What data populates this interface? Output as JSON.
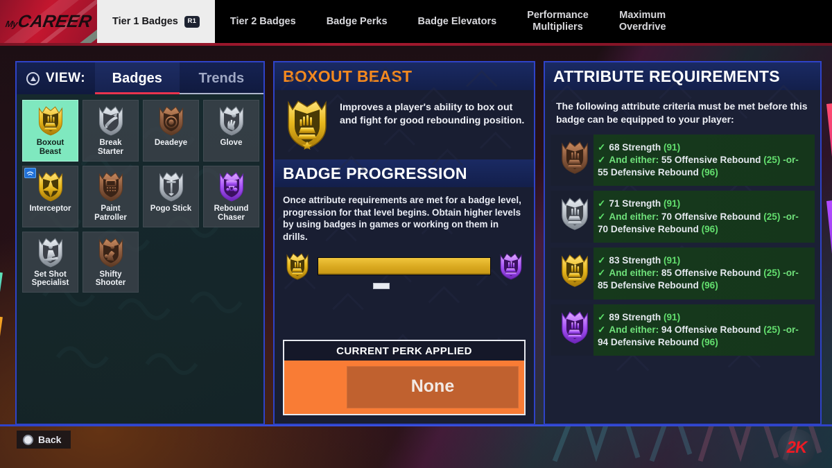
{
  "header": {
    "logo": {
      "prefix": "My",
      "main": "CAREER"
    },
    "tabs": [
      {
        "label": "Tier 1 Badges",
        "active": true,
        "shortcut": "R1"
      },
      {
        "label": "Tier 2 Badges",
        "active": false,
        "shortcut": ""
      },
      {
        "label": "Badge Perks",
        "active": false,
        "shortcut": ""
      },
      {
        "label": "Badge Elevators",
        "active": false,
        "shortcut": ""
      },
      {
        "label": "Performance\nMultipliers",
        "active": false,
        "shortcut": ""
      },
      {
        "label": "Maximum\nOverdrive",
        "active": false,
        "shortcut": ""
      }
    ]
  },
  "left": {
    "view_label": "VIEW:",
    "view_tabs": [
      {
        "label": "Badges",
        "active": true
      },
      {
        "label": "Trends",
        "active": false
      }
    ],
    "badges": [
      {
        "name": "Boxout\nBeast",
        "tier": "gold",
        "selected": true,
        "equipped": false,
        "art": "boxout"
      },
      {
        "name": "Break\nStarter",
        "tier": "silver",
        "selected": false,
        "equipped": false,
        "art": "break"
      },
      {
        "name": "Deadeye",
        "tier": "bronze",
        "selected": false,
        "equipped": false,
        "art": "deadeye"
      },
      {
        "name": "Glove",
        "tier": "silver",
        "selected": false,
        "equipped": false,
        "art": "glove"
      },
      {
        "name": "Interceptor",
        "tier": "gold",
        "selected": false,
        "equipped": true,
        "art": "interceptor"
      },
      {
        "name": "Paint\nPatroller",
        "tier": "bronze",
        "selected": false,
        "equipped": false,
        "art": "paint"
      },
      {
        "name": "Pogo Stick",
        "tier": "silver",
        "selected": false,
        "equipped": false,
        "art": "pogo"
      },
      {
        "name": "Rebound\nChaser",
        "tier": "hof",
        "selected": false,
        "equipped": false,
        "art": "rebound"
      },
      {
        "name": "Set Shot\nSpecialist",
        "tier": "silver",
        "selected": false,
        "equipped": false,
        "art": "setshot"
      },
      {
        "name": "Shifty\nShooter",
        "tier": "bronze",
        "selected": false,
        "equipped": false,
        "art": "shifty"
      }
    ]
  },
  "center": {
    "badge_title": "BOXOUT BEAST",
    "badge_description": "Improves a player's ability to box out and fight for good rebounding position.",
    "progression_title": "BADGE PROGRESSION",
    "progression_description": "Once attribute requirements are met for a badge level, progression for that level begins. Obtain higher levels by using badges in games or working on them in drills.",
    "progression_fill_percent": 100,
    "progression_marker_percent": 33,
    "progression_start_tier": "gold",
    "progression_end_tier": "hof",
    "perk_title": "CURRENT PERK APPLIED",
    "perk_value": "None"
  },
  "right": {
    "title": "ATTRIBUTE REQUIREMENTS",
    "intro": "The following attribute criteria must be met before this badge can be equipped to your player:",
    "requirements": [
      {
        "tier": "bronze",
        "strength_req": "68",
        "strength_label": "Strength",
        "strength_current": "91",
        "either_label": "And either:",
        "off_reb_req": "55",
        "off_reb_label": "Offensive Rebound",
        "off_reb_current": "25",
        "or_label": "-or-",
        "def_reb_req": "55",
        "def_reb_label": "Defensive Rebound",
        "def_reb_current": "96",
        "met": true
      },
      {
        "tier": "silver",
        "strength_req": "71",
        "strength_label": "Strength",
        "strength_current": "91",
        "either_label": "And either:",
        "off_reb_req": "70",
        "off_reb_label": "Offensive Rebound",
        "off_reb_current": "25",
        "or_label": "-or-",
        "def_reb_req": "70",
        "def_reb_label": "Defensive Rebound",
        "def_reb_current": "96",
        "met": true
      },
      {
        "tier": "gold",
        "strength_req": "83",
        "strength_label": "Strength",
        "strength_current": "91",
        "either_label": "And either:",
        "off_reb_req": "85",
        "off_reb_label": "Offensive Rebound",
        "off_reb_current": "25",
        "or_label": "-or-",
        "def_reb_req": "85",
        "def_reb_label": "Defensive Rebound",
        "def_reb_current": "96",
        "met": true
      },
      {
        "tier": "hof",
        "strength_req": "89",
        "strength_label": "Strength",
        "strength_current": "91",
        "either_label": "And either:",
        "off_reb_req": "94",
        "off_reb_label": "Offensive Rebound",
        "off_reb_current": "25",
        "or_label": "-or-",
        "def_reb_req": "94",
        "def_reb_label": "Defensive Rebound",
        "def_reb_current": "96",
        "met": true
      }
    ]
  },
  "footer": {
    "back_label": "Back",
    "back_button_icon": "circle-button-icon",
    "brand": "2K"
  },
  "colors": {
    "accent_blue": "#2f43c8",
    "selected_teal": "#7fe8bf",
    "title_orange": "#f3891f",
    "perk_orange": "#f97c35",
    "req_green": "#63df6e",
    "brand_red": "#ef1a24",
    "tier_bronze": "#8a5a3e",
    "tier_silver": "#b9c0c8",
    "tier_gold": "#e8b81d",
    "tier_hof": "#a855f7"
  }
}
